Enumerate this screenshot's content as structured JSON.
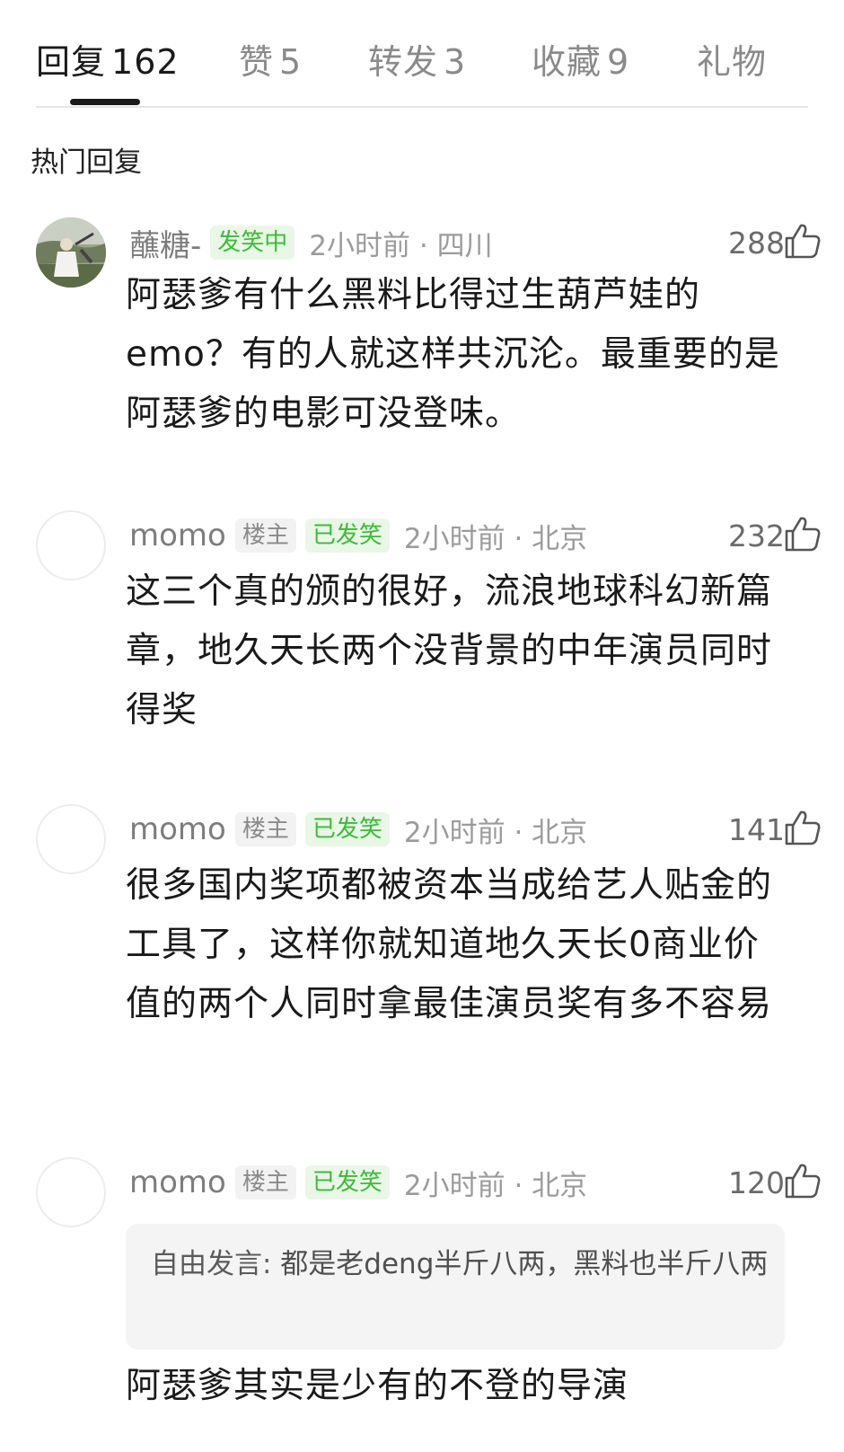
{
  "tabs": [
    {
      "label": "回复",
      "count": "162",
      "active": true
    },
    {
      "label": "赞",
      "count": "5",
      "active": false
    },
    {
      "label": "转发",
      "count": "3",
      "active": false
    },
    {
      "label": "收藏",
      "count": "9",
      "active": false
    },
    {
      "label": "礼物",
      "count": "",
      "active": false
    }
  ],
  "section_title": "热门回复",
  "comments": [
    {
      "username": "蘸糖-",
      "badges": [
        {
          "text": "发笑中",
          "style": "green"
        }
      ],
      "time_location": "2小时前 · 四川",
      "likes": "288",
      "text": "阿瑟爹有什么黑料比得过生葫芦娃的emo？有的人就这样共沉沦。最重要的是阿瑟爹的电影可没登味。"
    },
    {
      "username": "momo",
      "badges": [
        {
          "text": "楼主",
          "style": "host"
        },
        {
          "text": "已发笑",
          "style": "green"
        }
      ],
      "time_location": "2小时前 · 北京",
      "likes": "232",
      "text": "这三个真的颁的很好，流浪地球科幻新篇章，地久天长两个没背景的中年演员同时得奖"
    },
    {
      "username": "momo",
      "badges": [
        {
          "text": "楼主",
          "style": "host"
        },
        {
          "text": "已发笑",
          "style": "green"
        }
      ],
      "time_location": "2小时前 · 北京",
      "likes": "141",
      "text": "很多国内奖项都被资本当成给艺人贴金的工具了，这样你就知道地久天长0商业价值的两个人同时拿最佳演员奖有多不容易"
    },
    {
      "username": "momo",
      "badges": [
        {
          "text": "楼主",
          "style": "host"
        },
        {
          "text": "已发笑",
          "style": "green"
        }
      ],
      "time_location": "2小时前 · 北京",
      "likes": "120",
      "quote": {
        "author": "自由发言:",
        "text": " 都是老deng半斤八两，黑料也半斤八两"
      },
      "text": "阿瑟爹其实是少有的不登的导演"
    }
  ],
  "colors": {
    "accent_green": "#3dba3b",
    "badge_green_bg": "#e9f7e6",
    "text_primary": "#1a1a1a",
    "text_secondary": "#9b9b9b"
  },
  "icons": {
    "like": "thumbs-up-icon"
  }
}
